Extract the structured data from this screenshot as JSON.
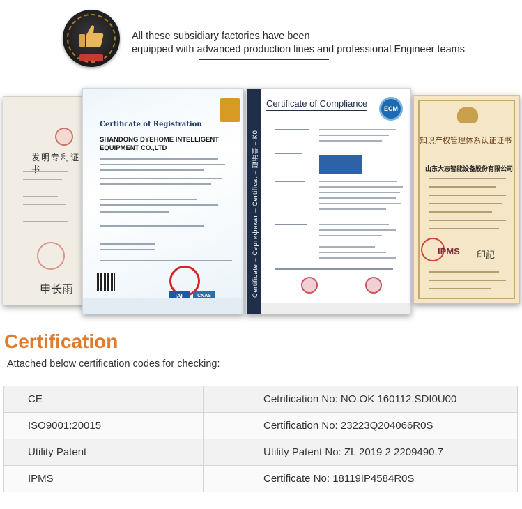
{
  "intro": {
    "line1": "All these subsidiary factories have been",
    "line2": "equipped with advanced production lines and professional Engineer teams",
    "badge_icon": "thumbs-up-icon"
  },
  "certificates": {
    "patent": {
      "title": "发明专利证书",
      "signature": "申长雨"
    },
    "registration": {
      "title": "Certificate of Registration",
      "company": "SHANDONG DYEHOME INTELLIGENT EQUIPMENT CO.,LTD",
      "logos": [
        "IAF",
        "CNAS"
      ]
    },
    "compliance": {
      "title": "Certificate of Compliance",
      "side_text": "Certificate – Сертификат – Certificat – 證明書 – K0",
      "badge": "ECM"
    },
    "ipms": {
      "title": "知识产权管理体系认证证书",
      "company": "山东大志智能设备股份有限公司",
      "logo": "IPMS",
      "signature": "印記"
    }
  },
  "section": {
    "heading": "Certification",
    "subheading": "Attached below certification codes for checking:"
  },
  "table": {
    "rows": [
      {
        "name": "CE",
        "code": "Cetrification No: NO.OK 160112.SDI0U00"
      },
      {
        "name": "ISO9001:20015",
        "code": "Certification No: 23223Q204066R0S"
      },
      {
        "name": "Utility Patent",
        "code": "Utility Patent No: ZL 2019 2 2209490.7"
      },
      {
        "name": "IPMS",
        "code": "Certificate No: 18119IP4584R0S"
      }
    ]
  },
  "colors": {
    "accent": "#e07b2b"
  }
}
